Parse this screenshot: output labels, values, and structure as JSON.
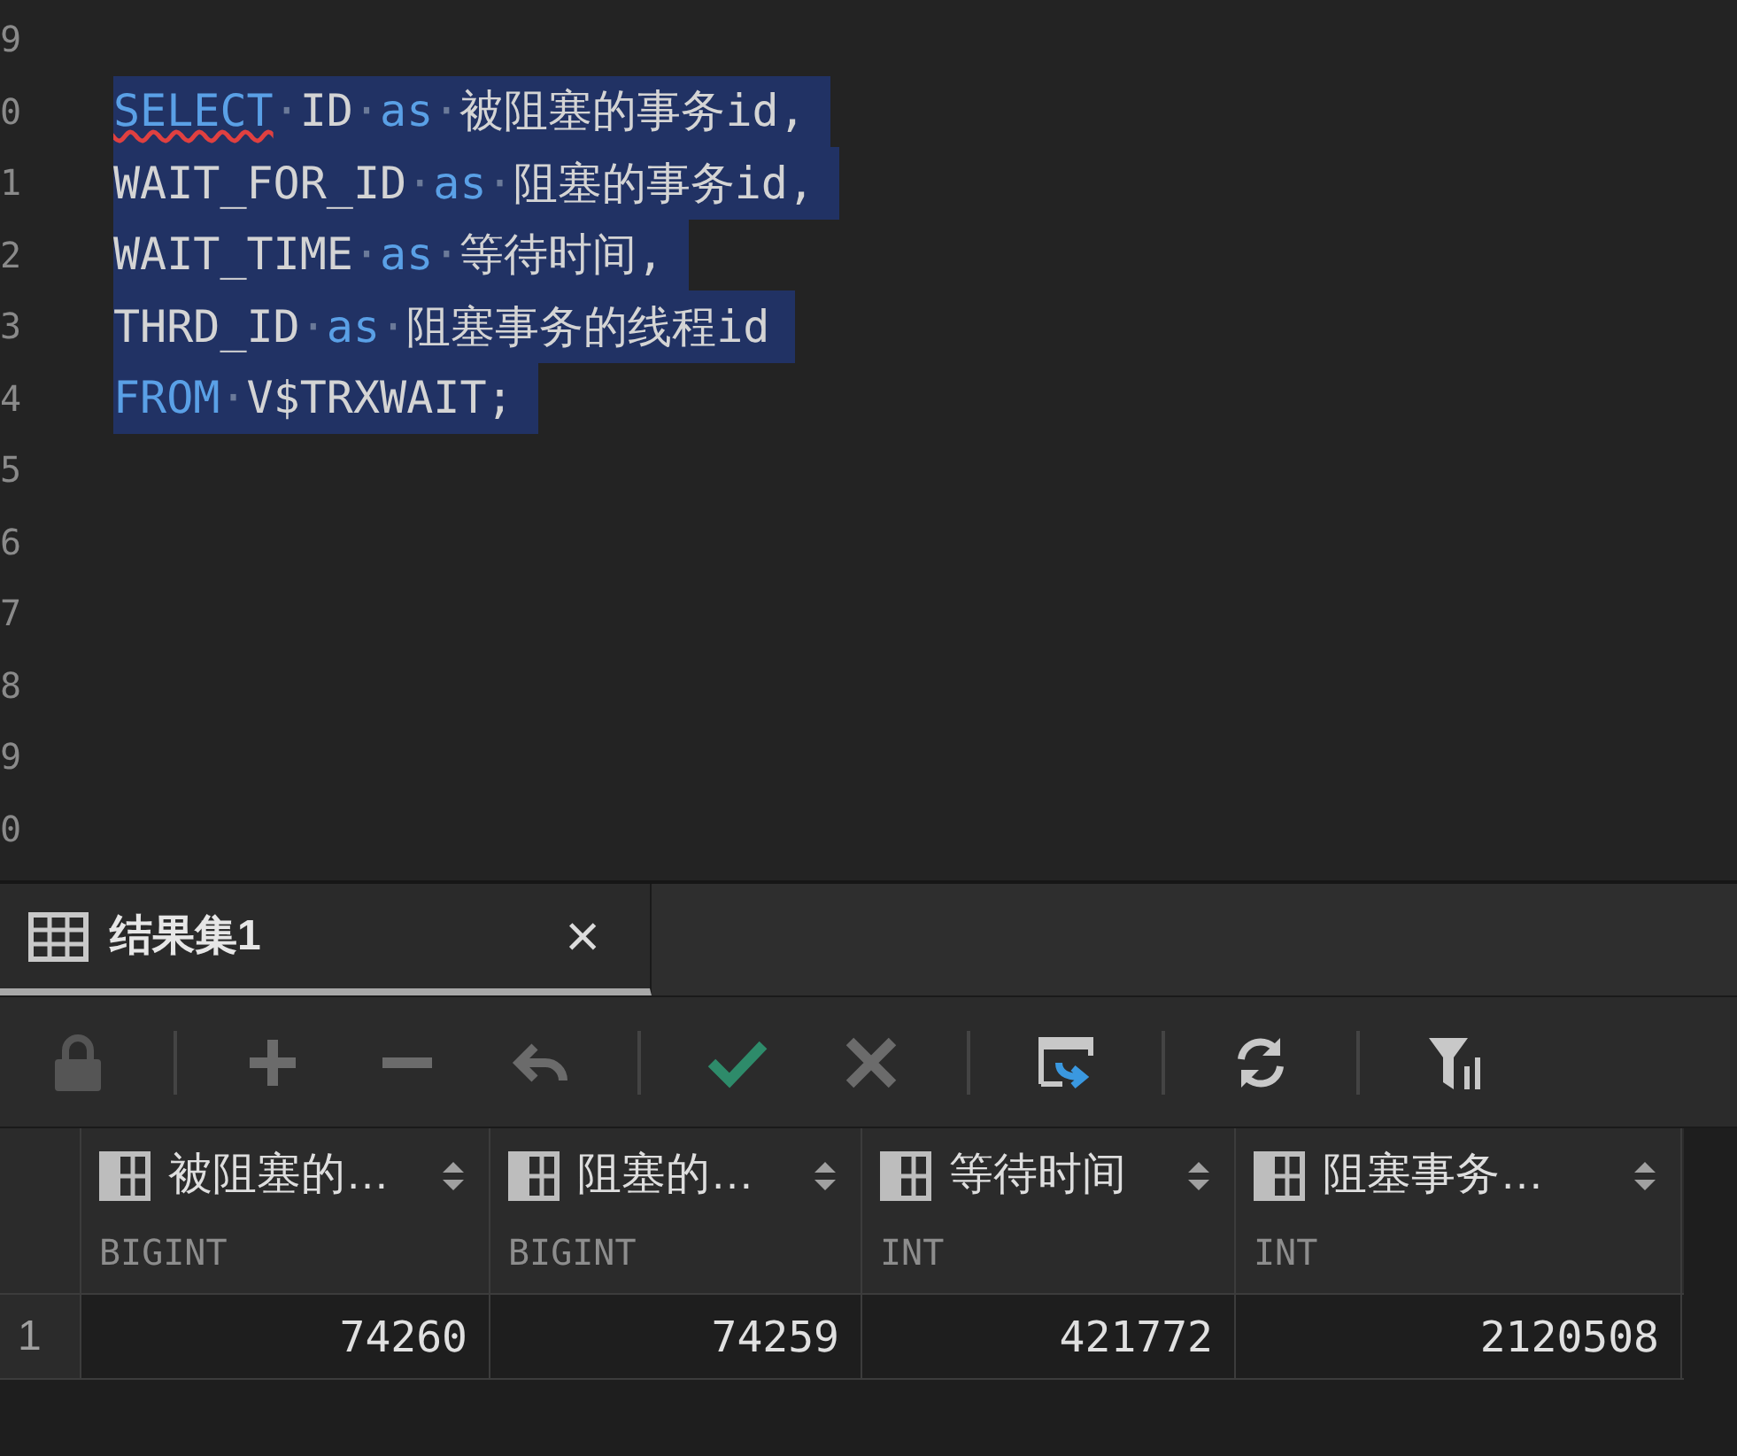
{
  "editor": {
    "lines": [
      {
        "number": "9",
        "selected": false
      },
      {
        "number": "0",
        "selected": true,
        "tokens": [
          {
            "text": "SELECT",
            "kind": "keyword",
            "error": true
          },
          {
            "text": "·",
            "kind": "whitespace"
          },
          {
            "text": "ID",
            "kind": "identifier"
          },
          {
            "text": "·",
            "kind": "whitespace"
          },
          {
            "text": "as",
            "kind": "keyword"
          },
          {
            "text": "·",
            "kind": "whitespace"
          },
          {
            "text": "被阻塞的事务id,",
            "kind": "identifier"
          }
        ]
      },
      {
        "number": "1",
        "selected": true,
        "tokens": [
          {
            "text": "WAIT_FOR_ID",
            "kind": "identifier"
          },
          {
            "text": "·",
            "kind": "whitespace"
          },
          {
            "text": "as",
            "kind": "keyword"
          },
          {
            "text": "·",
            "kind": "whitespace"
          },
          {
            "text": "阻塞的事务id,",
            "kind": "identifier"
          }
        ]
      },
      {
        "number": "2",
        "selected": true,
        "tokens": [
          {
            "text": "WAIT_TIME",
            "kind": "identifier"
          },
          {
            "text": "·",
            "kind": "whitespace"
          },
          {
            "text": "as",
            "kind": "keyword"
          },
          {
            "text": "·",
            "kind": "whitespace"
          },
          {
            "text": "等待时间,",
            "kind": "identifier"
          }
        ]
      },
      {
        "number": "3",
        "selected": true,
        "tokens": [
          {
            "text": "THRD_ID",
            "kind": "identifier"
          },
          {
            "text": "·",
            "kind": "whitespace"
          },
          {
            "text": "as",
            "kind": "keyword"
          },
          {
            "text": "·",
            "kind": "whitespace"
          },
          {
            "text": "阻塞事务的线程id",
            "kind": "identifier"
          }
        ]
      },
      {
        "number": "4",
        "selected": true,
        "tokens": [
          {
            "text": "FROM",
            "kind": "keyword"
          },
          {
            "text": "·",
            "kind": "whitespace"
          },
          {
            "text": "V$TRXWAIT;",
            "kind": "identifier"
          }
        ]
      },
      {
        "number": "5",
        "selected": false
      },
      {
        "number": "6",
        "selected": false
      },
      {
        "number": "7",
        "selected": false
      },
      {
        "number": "8",
        "selected": false
      },
      {
        "number": "9",
        "selected": false
      },
      {
        "number": "0",
        "selected": false
      }
    ]
  },
  "result_tabs": [
    {
      "label": "结果集1",
      "selected": true,
      "close": "×"
    }
  ],
  "toolbar": [
    {
      "kind": "lock",
      "disabled": true
    },
    {
      "kind": "separator"
    },
    {
      "kind": "add",
      "disabled": true
    },
    {
      "kind": "remove",
      "disabled": true
    },
    {
      "kind": "undo",
      "disabled": true
    },
    {
      "kind": "separator"
    },
    {
      "kind": "commit",
      "disabled": false
    },
    {
      "kind": "cancel",
      "disabled": true
    },
    {
      "kind": "separator"
    },
    {
      "kind": "export",
      "disabled": false
    },
    {
      "kind": "separator"
    },
    {
      "kind": "refresh",
      "disabled": false
    },
    {
      "kind": "separator"
    },
    {
      "kind": "filter",
      "disabled": false
    }
  ],
  "table": {
    "columns": [
      {
        "name": "被阻塞的…",
        "type": "BIGINT"
      },
      {
        "name": "阻塞的…",
        "type": "BIGINT"
      },
      {
        "name": "等待时间",
        "type": "INT"
      },
      {
        "name": "阻塞事务…",
        "type": "INT"
      }
    ],
    "rows": [
      {
        "number": "1",
        "cells": [
          "74260",
          "74259",
          "421772",
          "2120508"
        ]
      }
    ]
  }
}
